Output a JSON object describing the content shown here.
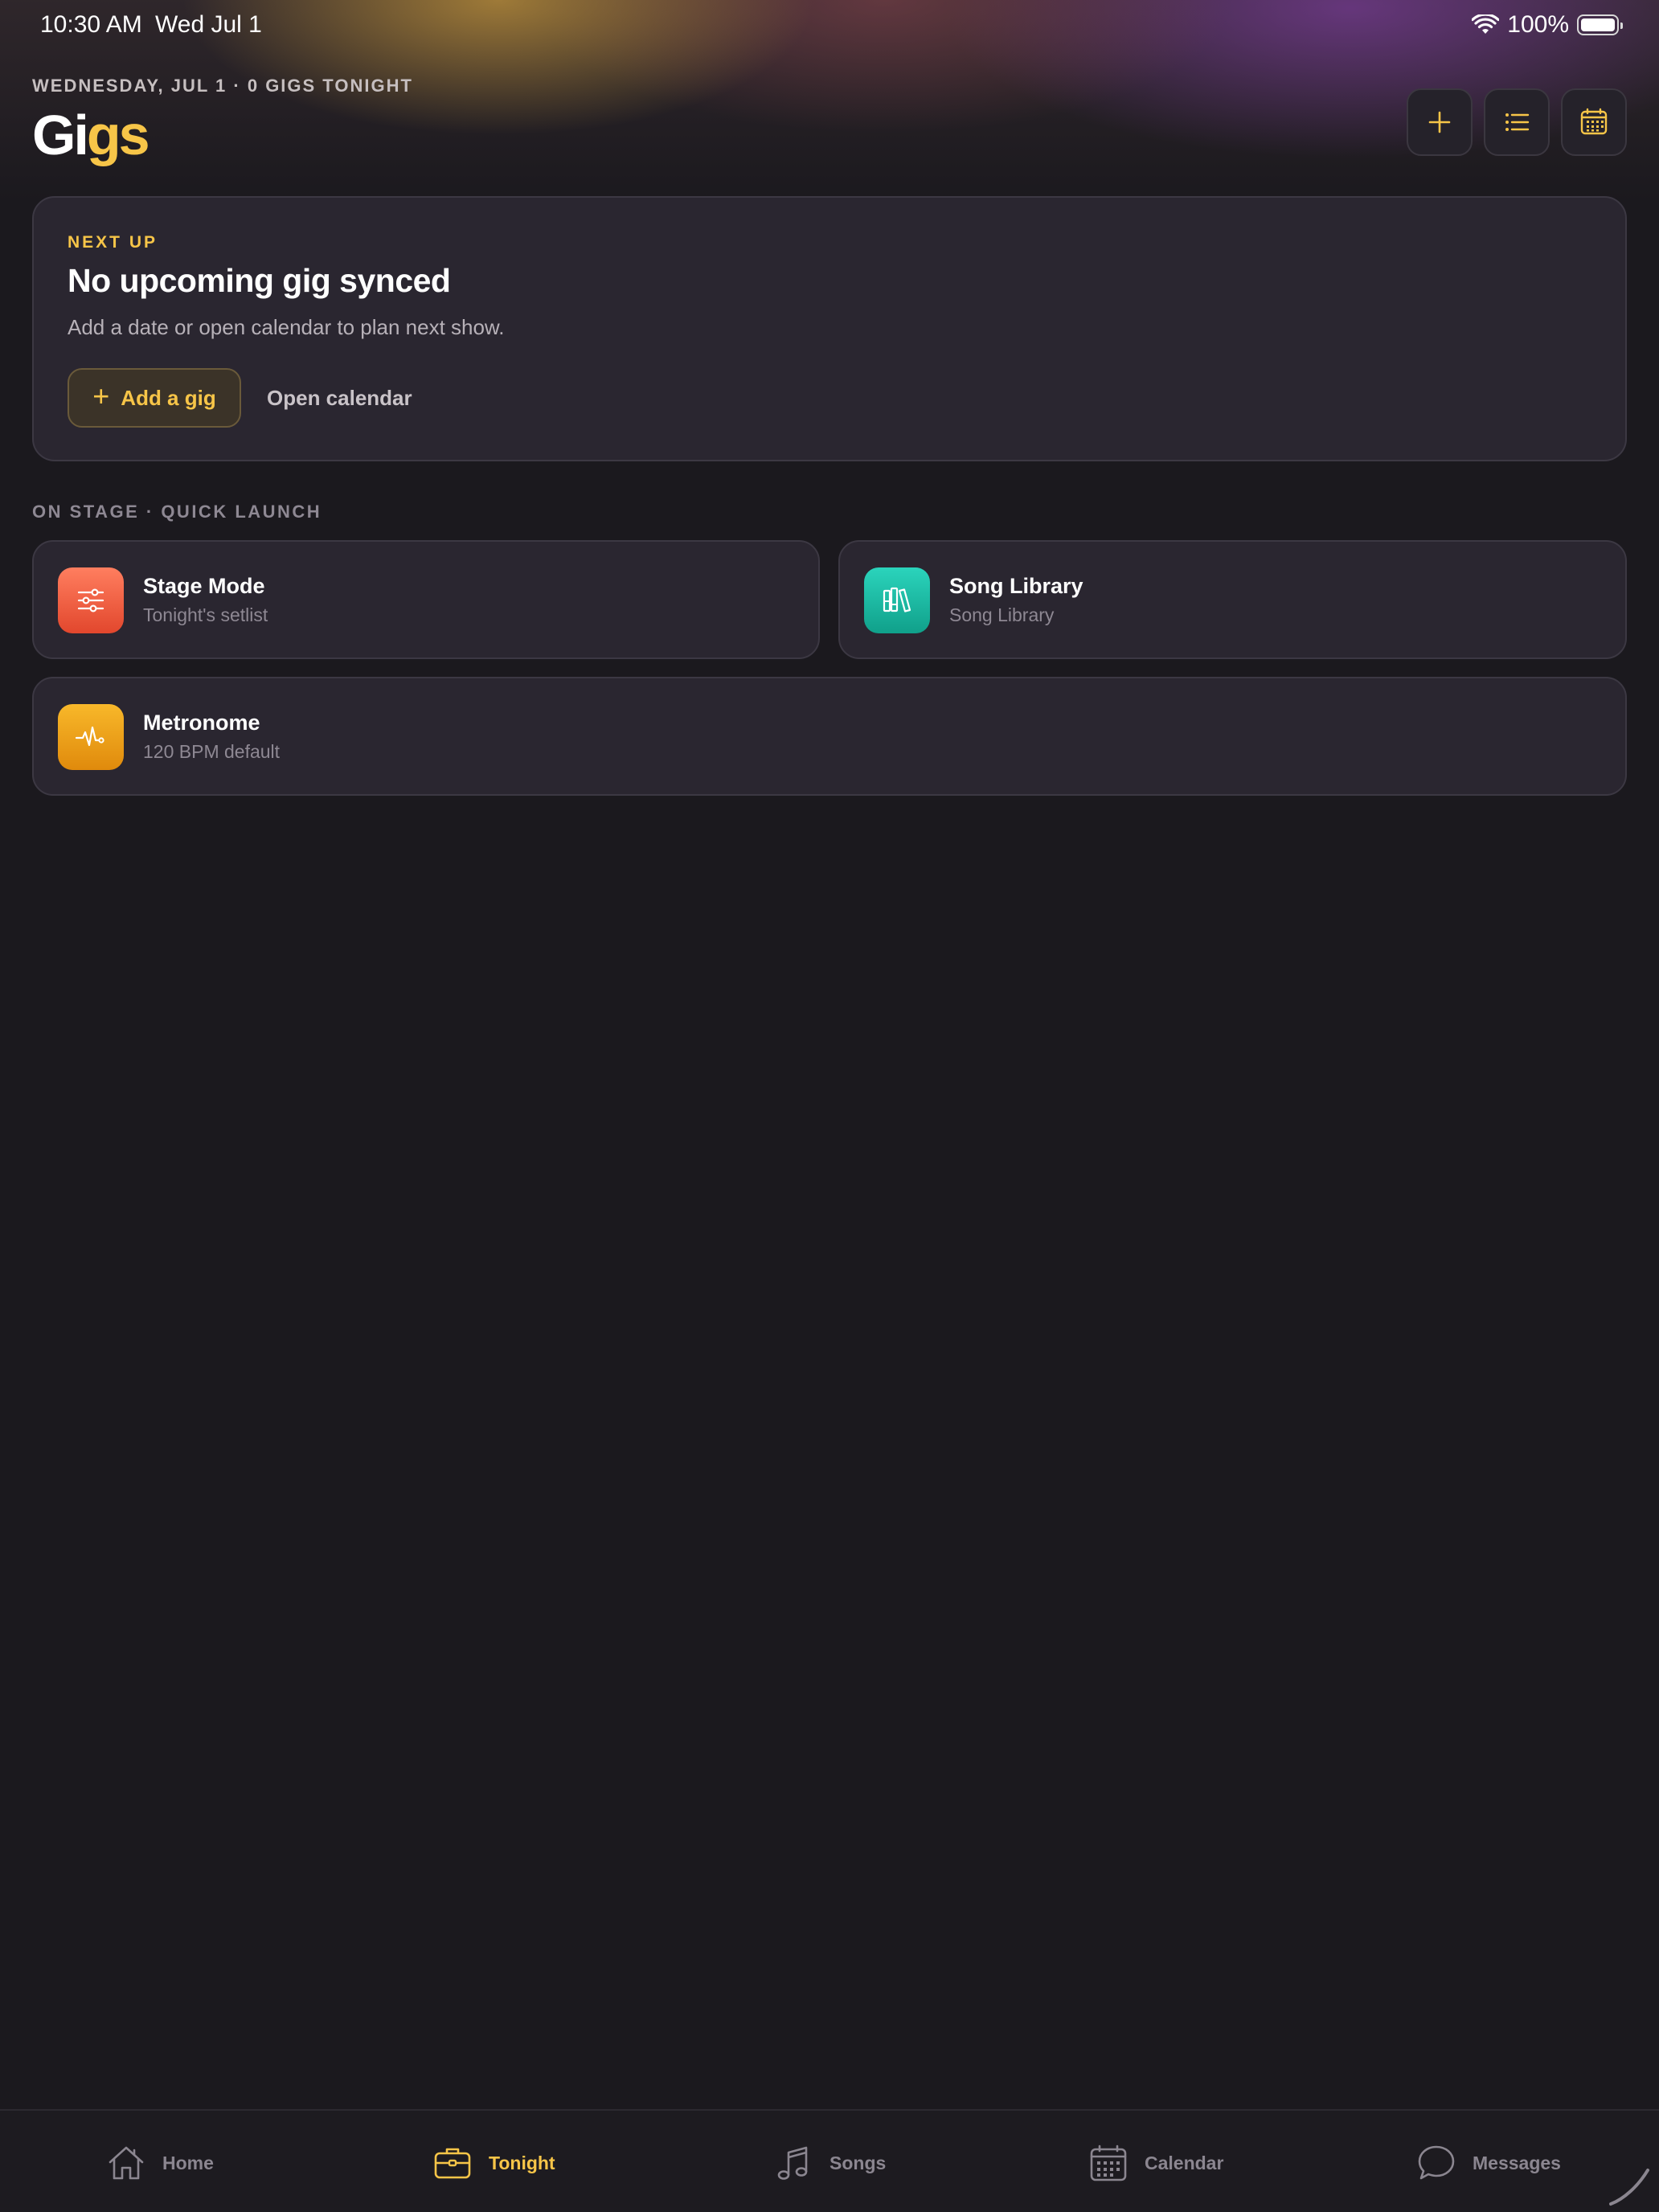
{
  "status_bar": {
    "time": "10:30 AM",
    "date": "Wed Jul 1",
    "battery": "100%",
    "icons": [
      "wifi-icon",
      "battery-icon"
    ]
  },
  "header": {
    "subheading": "WEDNESDAY, JUL 1 · 0 GIGS TONIGHT",
    "title_part1": "Gi",
    "title_part2": "gs",
    "actions": [
      "plus-icon",
      "list-icon",
      "calendar-icon"
    ]
  },
  "next_up": {
    "label": "NEXT UP",
    "title": "No upcoming gig synced",
    "description": "Add a date or open calendar to plan next show.",
    "primary_button": "Add a gig",
    "secondary_button": "Open calendar"
  },
  "quick_launch": {
    "label": "ON STAGE · QUICK LAUNCH",
    "tiles": [
      {
        "title": "Stage Mode",
        "subtitle": "Tonight's setlist",
        "icon": "sliders-icon"
      },
      {
        "title": "Song Library",
        "subtitle": "Song Library",
        "icon": "books-icon"
      },
      {
        "title": "Metronome",
        "subtitle": "120 BPM default",
        "icon": "pulse-icon"
      }
    ]
  },
  "tabs": [
    {
      "label": "Home",
      "icon": "home-icon",
      "active": false
    },
    {
      "label": "Tonight",
      "icon": "briefcase-icon",
      "active": true
    },
    {
      "label": "Songs",
      "icon": "music-note-icon",
      "active": false
    },
    {
      "label": "Calendar",
      "icon": "calendar-icon",
      "active": false
    },
    {
      "label": "Messages",
      "icon": "message-bubble-icon",
      "active": false
    }
  ],
  "colors": {
    "background": "#1b191e",
    "card": "#2a2630",
    "accent": "#f7c548",
    "muted": "#8e8893"
  }
}
